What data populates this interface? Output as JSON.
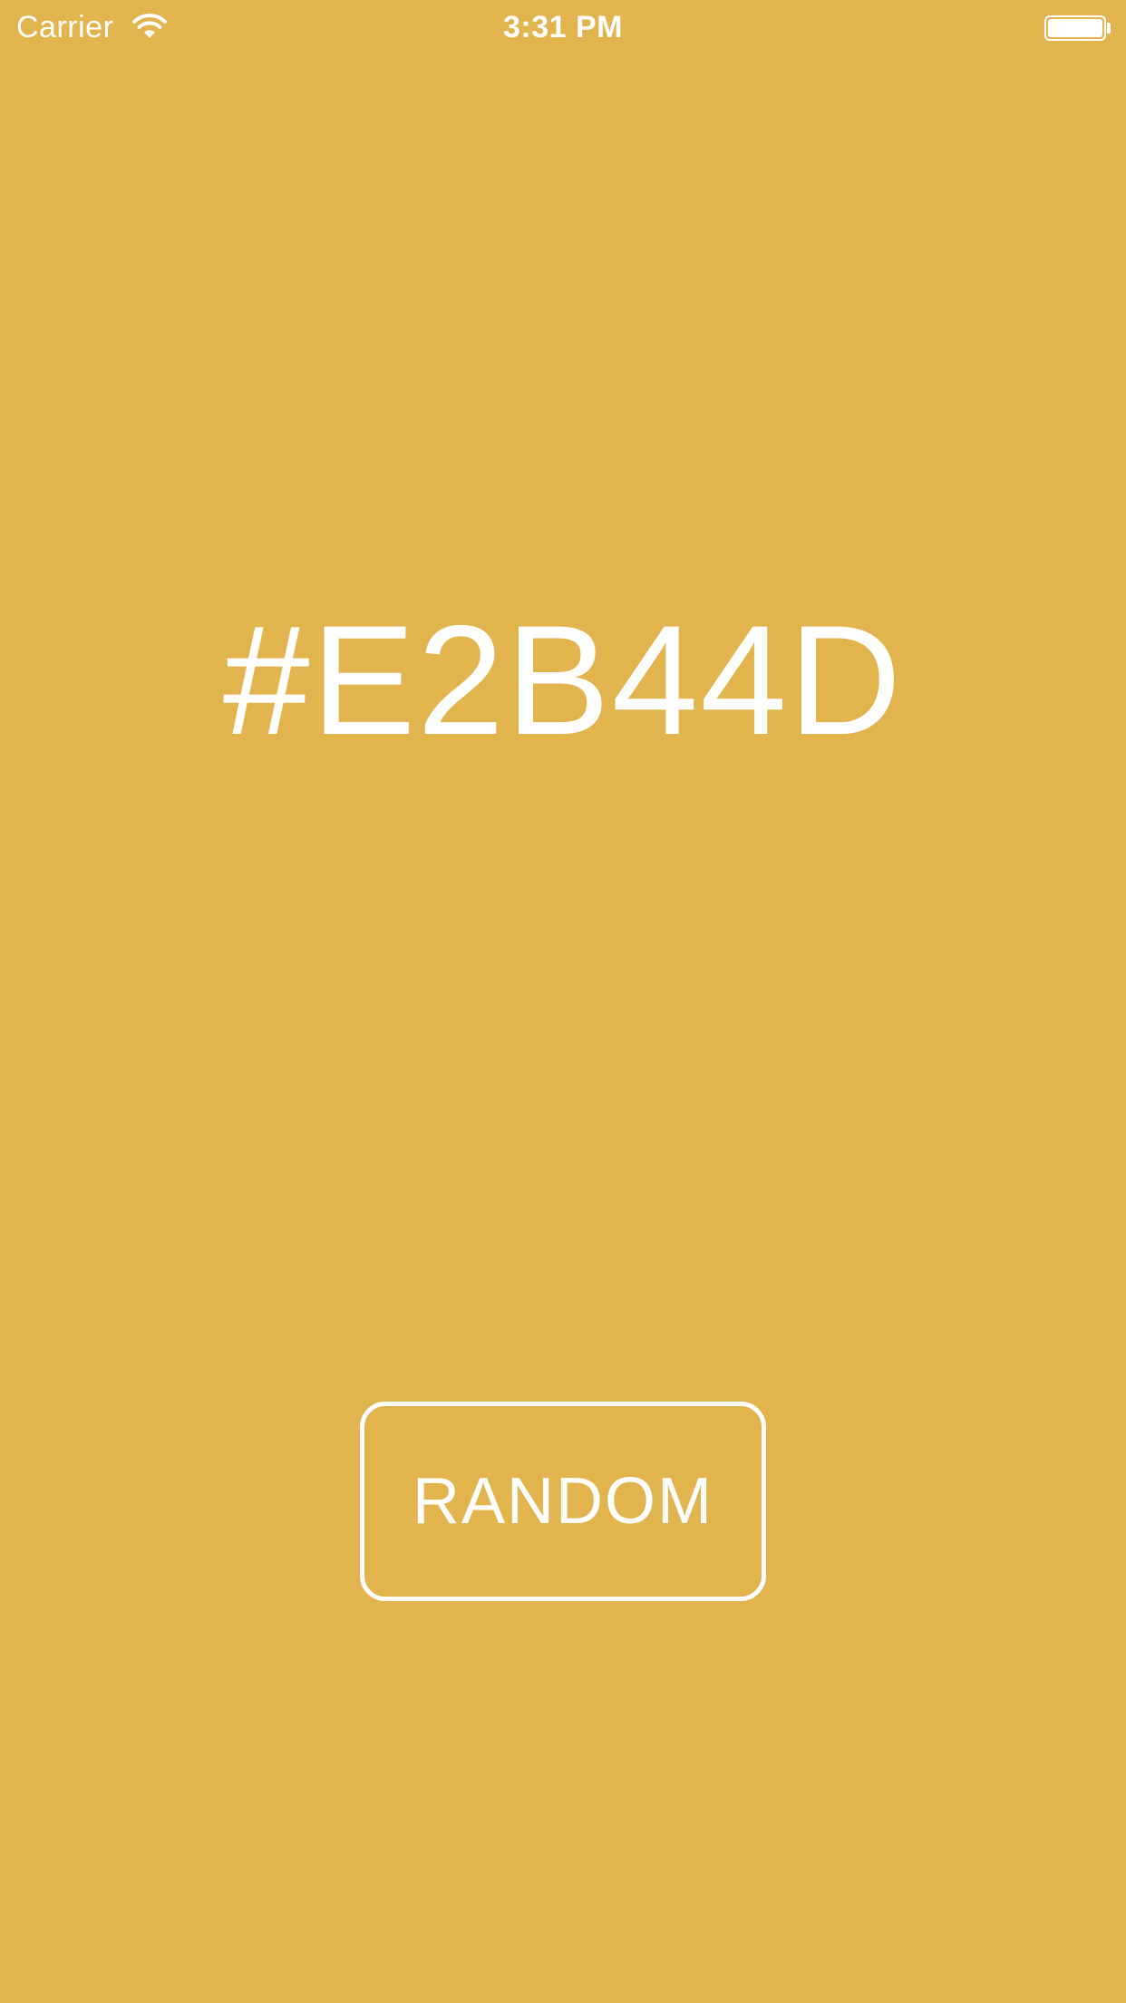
{
  "status_bar": {
    "carrier": "Carrier",
    "time": "3:31 PM",
    "wifi_icon": "wifi-icon",
    "battery_icon": "battery-icon",
    "battery_level": 1.0
  },
  "main": {
    "hex_value": "#E2B44D",
    "random_button_label": "RANDOM"
  },
  "colors": {
    "background": "#E2B44D",
    "foreground": "#FFFFFF"
  }
}
